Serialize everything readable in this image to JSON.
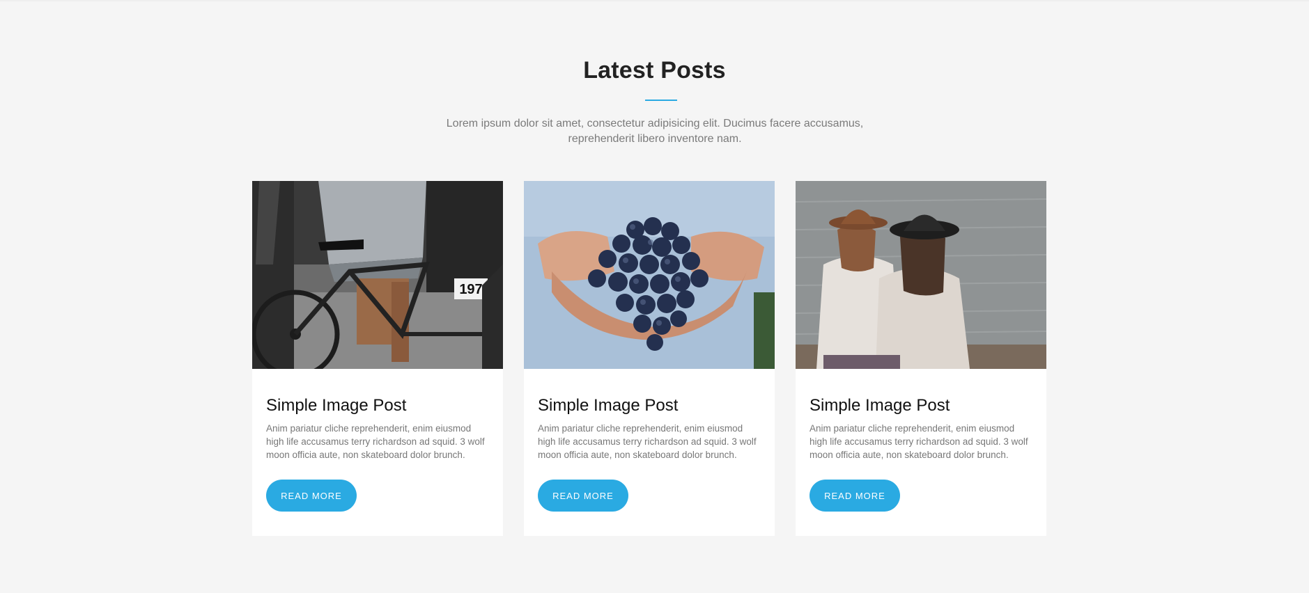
{
  "section": {
    "title": "Latest Posts",
    "subtitle_line1": "Lorem ipsum dolor sit amet, consectetur adipisicing elit. Ducimus facere accusamus,",
    "subtitle_line2": "reprehenderit libero inventore nam."
  },
  "posts": [
    {
      "title": "Simple Image Post",
      "excerpt": "Anim pariatur cliche reprehenderit, enim eiusmod high life accusamus terry richardson ad squid. 3 wolf moon officia aute, non skateboard dolor brunch.",
      "button_label": "READ MORE",
      "image_badge_number": "197"
    },
    {
      "title": "Simple Image Post",
      "excerpt": "Anim pariatur cliche reprehenderit, enim eiusmod high life accusamus terry richardson ad squid. 3 wolf moon officia aute, non skateboard dolor brunch.",
      "button_label": "READ MORE"
    },
    {
      "title": "Simple Image Post",
      "excerpt": "Anim pariatur cliche reprehenderit, enim eiusmod high life accusamus terry richardson ad squid. 3 wolf moon officia aute, non skateboard dolor brunch.",
      "button_label": "READ MORE"
    }
  ],
  "colors": {
    "accent": "#2aaae2",
    "background": "#f5f5f5",
    "card": "#ffffff",
    "heading": "#222222",
    "body_text": "#777777"
  }
}
